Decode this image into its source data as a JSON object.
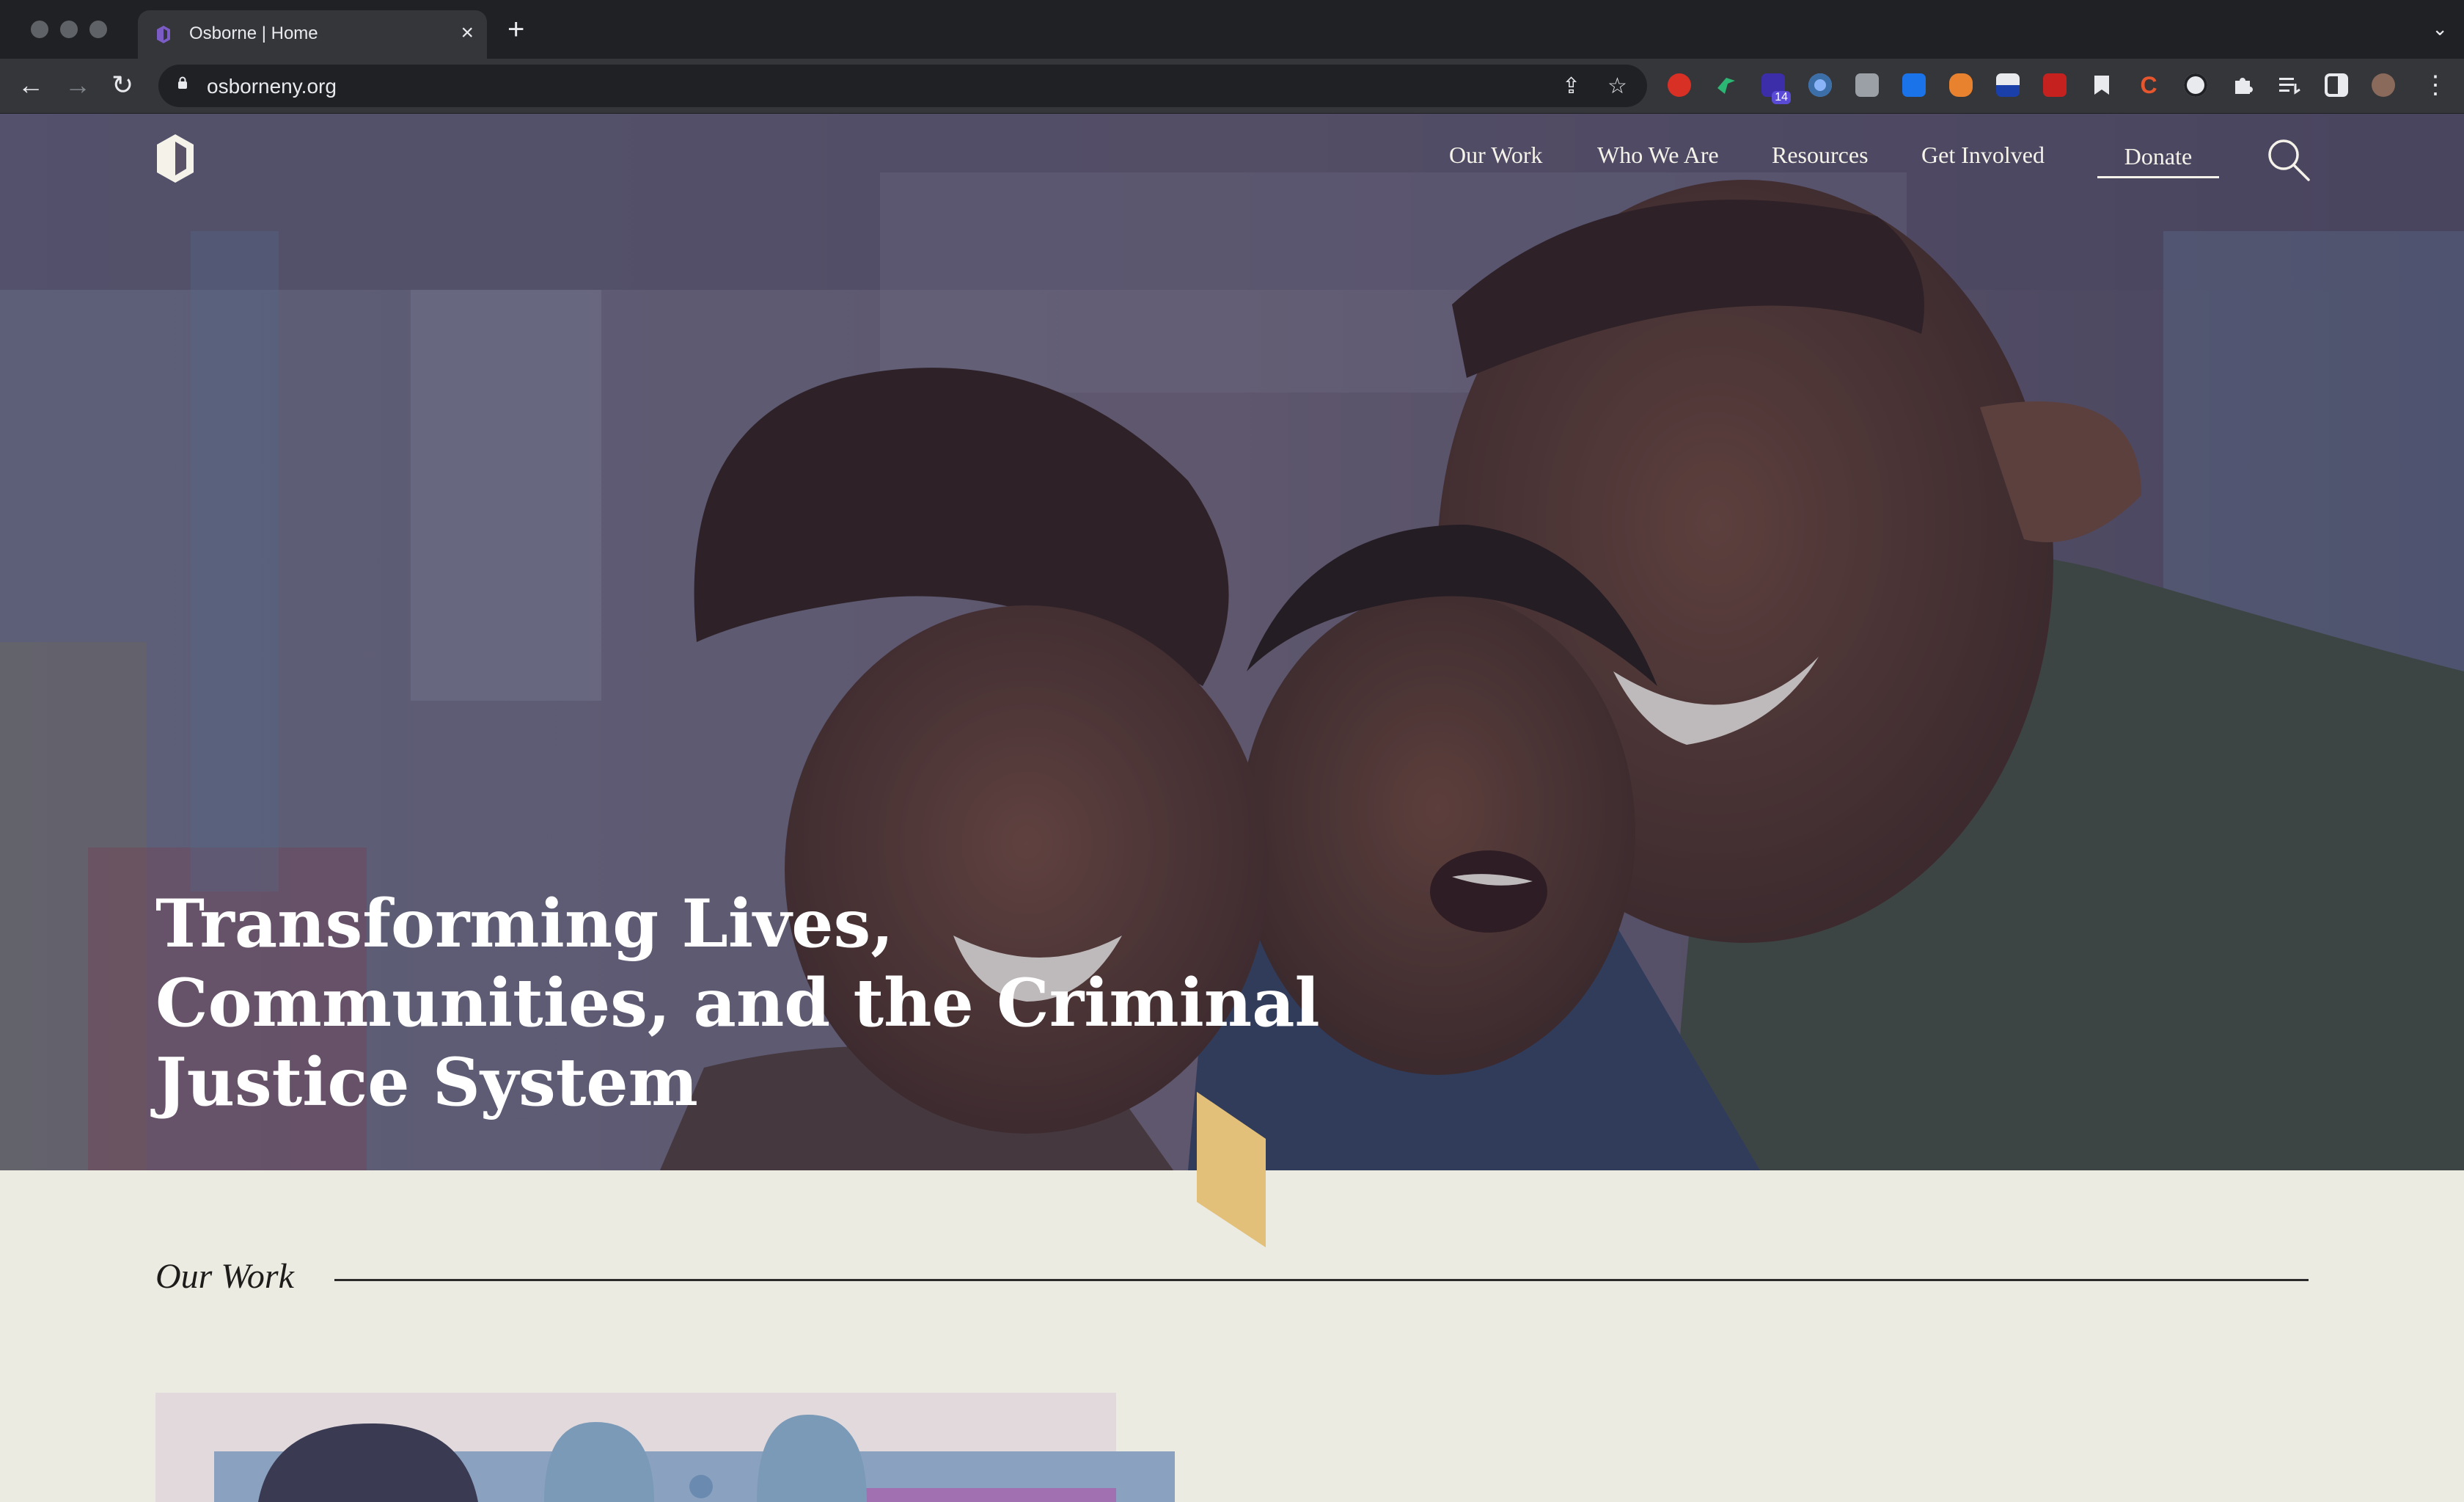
{
  "browser": {
    "tab_title": "Osborne | Home",
    "tab_close": "×",
    "new_tab": "+",
    "tab_menu": "⌄",
    "url": "osborneny.org",
    "back": "←",
    "forward": "→",
    "reload": "↻",
    "share_icon": "⇪",
    "bookmark_icon": "☆",
    "menu_icon": "⋮",
    "extension_badge": "14",
    "extensions": [
      "adblock-icon",
      "hummingbird-icon",
      "badge-ext-icon",
      "circle-ext-icon",
      "grey-ext-icon",
      "translate-ext-icon",
      "fox-ext-icon",
      "flag-ext-icon",
      "stamp-ext-icon",
      "bookmark-ext-icon",
      "c-ext-icon",
      "a-circle-icon",
      "puzzle-icon",
      "queue-icon",
      "sidepanel-icon",
      "profile-avatar"
    ]
  },
  "site": {
    "nav": [
      "Our Work",
      "Who We Are",
      "Resources",
      "Get Involved"
    ],
    "donate": "Donate",
    "hero_title_lines": [
      "Transforming Lives,",
      "Communities, and the Criminal",
      "Justice System"
    ],
    "section_title": "Our Work",
    "colors": {
      "hero_overlay": "#5a5368",
      "accent_gold": "#e2c07a",
      "page_bg": "#ecebe1",
      "logo_purple": "#7b5cc4"
    }
  }
}
